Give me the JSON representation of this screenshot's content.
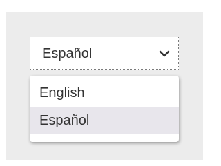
{
  "language_select": {
    "selected_value": "Español",
    "chevron_icon": "chevron-down-icon",
    "options": [
      {
        "label": "English",
        "highlighted": false
      },
      {
        "label": "Español",
        "highlighted": true
      }
    ]
  },
  "colors": {
    "panel_background": "#ececec",
    "highlight_background": "#e8e6ec",
    "text": "#333333"
  }
}
